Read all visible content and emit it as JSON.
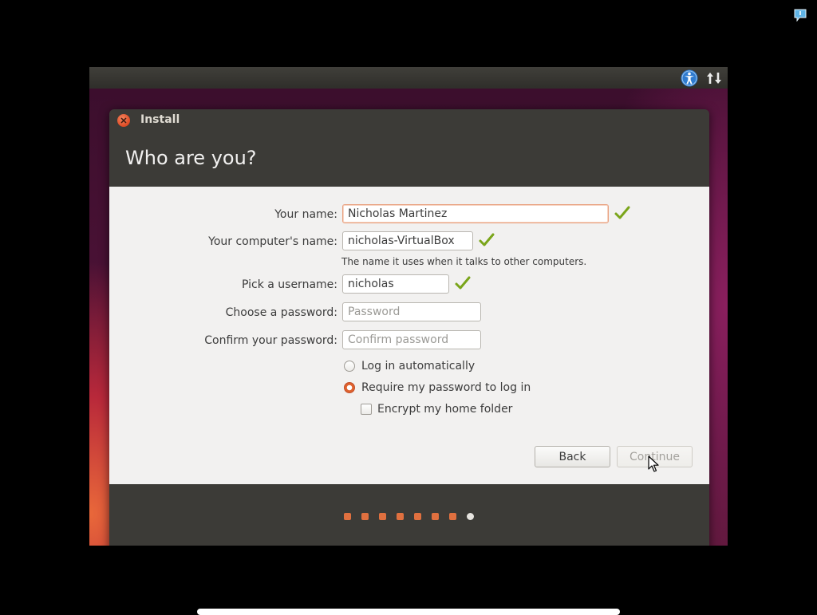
{
  "system": {
    "notification_icon": "notification-speech-icon",
    "topbar_icons": [
      "accessibility-icon",
      "network-updown-icon"
    ]
  },
  "window": {
    "title": "Install",
    "heading": "Who are you?"
  },
  "form": {
    "name": {
      "label": "Your name:",
      "value": "Nicholas Martinez",
      "valid": true
    },
    "computer": {
      "label": "Your computer's name:",
      "value": "nicholas-VirtualBox",
      "hint": "The name it uses when it talks to other computers.",
      "valid": true
    },
    "username": {
      "label": "Pick a username:",
      "value": "nicholas",
      "valid": true
    },
    "password": {
      "label": "Choose a password:",
      "placeholder": "Password",
      "value": ""
    },
    "confirm": {
      "label": "Confirm your password:",
      "placeholder": "Confirm password",
      "value": ""
    },
    "login_options": {
      "auto": {
        "label": "Log in automatically",
        "selected": false
      },
      "require": {
        "label": "Require my password to log in",
        "selected": true
      },
      "encrypt": {
        "label": "Encrypt my home folder",
        "checked": false
      }
    }
  },
  "buttons": {
    "back": "Back",
    "continue": "Continue",
    "continue_enabled": false
  },
  "progress": {
    "total_steps": 8,
    "current_step": 8
  },
  "colors": {
    "accent": "#e0622e",
    "check_green": "#7aa51a",
    "window_bg": "#3c3b37",
    "content_bg": "#f2f1f0"
  }
}
